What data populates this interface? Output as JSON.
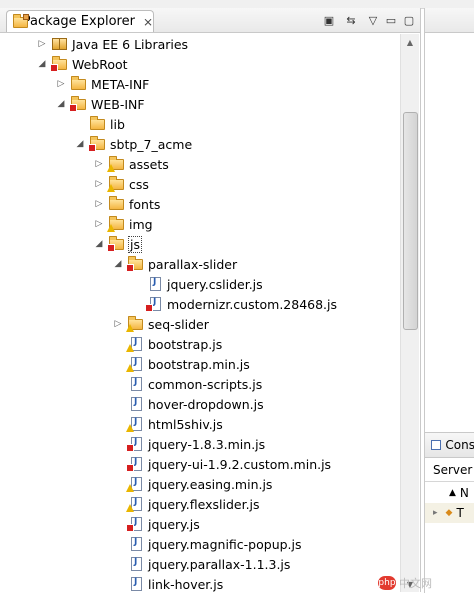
{
  "view": {
    "title": "Package Explorer",
    "close_glyph": "⨯",
    "toolbar": [
      {
        "name": "collapse-all-icon",
        "glyph": "▣"
      },
      {
        "name": "link-with-editor-icon",
        "glyph": "⇆"
      },
      {
        "name": "view-menu-icon",
        "glyph": "▽"
      },
      {
        "name": "minimize-icon",
        "glyph": "▭"
      },
      {
        "name": "maximize-icon",
        "glyph": "▢"
      }
    ]
  },
  "tree": [
    {
      "label": "Java EE 6 Libraries",
      "depth": 0,
      "twisty": "collapsed",
      "icon": "library"
    },
    {
      "label": "WebRoot",
      "depth": 0,
      "twisty": "expanded",
      "icon": "folder-error"
    },
    {
      "label": "META-INF",
      "depth": 1,
      "twisty": "collapsed",
      "icon": "folder"
    },
    {
      "label": "WEB-INF",
      "depth": 1,
      "twisty": "expanded",
      "icon": "folder-error"
    },
    {
      "label": "lib",
      "depth": 2,
      "twisty": "none",
      "icon": "folder"
    },
    {
      "label": "sbtp_7_acme",
      "depth": 2,
      "twisty": "expanded",
      "icon": "folder-error"
    },
    {
      "label": "assets",
      "depth": 3,
      "twisty": "collapsed",
      "icon": "folder-warning"
    },
    {
      "label": "css",
      "depth": 3,
      "twisty": "collapsed",
      "icon": "folder-warning"
    },
    {
      "label": "fonts",
      "depth": 3,
      "twisty": "collapsed",
      "icon": "folder"
    },
    {
      "label": "img",
      "depth": 3,
      "twisty": "collapsed",
      "icon": "folder-warning"
    },
    {
      "label": "js",
      "depth": 3,
      "twisty": "expanded",
      "icon": "folder-error",
      "selected": true
    },
    {
      "label": "parallax-slider",
      "depth": 4,
      "twisty": "expanded",
      "icon": "folder-error"
    },
    {
      "label": "jquery.cslider.js",
      "depth": 5,
      "twisty": "none",
      "icon": "js"
    },
    {
      "label": "modernizr.custom.28468.js",
      "depth": 5,
      "twisty": "none",
      "icon": "js-error"
    },
    {
      "label": "seq-slider",
      "depth": 4,
      "twisty": "collapsed",
      "icon": "folder-warning"
    },
    {
      "label": "bootstrap.js",
      "depth": 4,
      "twisty": "none",
      "icon": "js-warning"
    },
    {
      "label": "bootstrap.min.js",
      "depth": 4,
      "twisty": "none",
      "icon": "js-warning"
    },
    {
      "label": "common-scripts.js",
      "depth": 4,
      "twisty": "none",
      "icon": "js"
    },
    {
      "label": "hover-dropdown.js",
      "depth": 4,
      "twisty": "none",
      "icon": "js"
    },
    {
      "label": "html5shiv.js",
      "depth": 4,
      "twisty": "none",
      "icon": "js-warning"
    },
    {
      "label": "jquery-1.8.3.min.js",
      "depth": 4,
      "twisty": "none",
      "icon": "js-error"
    },
    {
      "label": "jquery-ui-1.9.2.custom.min.js",
      "depth": 4,
      "twisty": "none",
      "icon": "js-error"
    },
    {
      "label": "jquery.easing.min.js",
      "depth": 4,
      "twisty": "none",
      "icon": "js-warning"
    },
    {
      "label": "jquery.flexslider.js",
      "depth": 4,
      "twisty": "none",
      "icon": "js-warning"
    },
    {
      "label": "jquery.js",
      "depth": 4,
      "twisty": "none",
      "icon": "js-error"
    },
    {
      "label": "jquery.magnific-popup.js",
      "depth": 4,
      "twisty": "none",
      "icon": "js"
    },
    {
      "label": "jquery.parallax-1.1.3.js",
      "depth": 4,
      "twisty": "none",
      "icon": "js"
    },
    {
      "label": "link-hover.js",
      "depth": 4,
      "twisty": "none",
      "icon": "js"
    }
  ],
  "right_panel": {
    "tab_label": "Cons",
    "column_header": "Server",
    "rows": [
      {
        "label": "N"
      },
      {
        "label": "T"
      }
    ]
  },
  "watermark": {
    "logo_text": "php",
    "text": "中文网"
  }
}
